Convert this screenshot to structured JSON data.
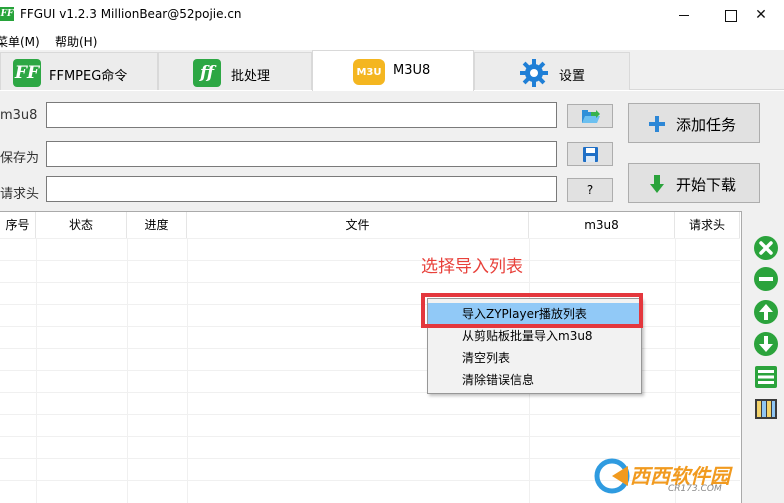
{
  "window": {
    "title": "FFGUI v1.2.3   MillionBear@52pojie.cn",
    "app_icon_text": "FF",
    "close_glyph": "✕"
  },
  "menu": {
    "items": [
      {
        "label": "菜单(M)"
      },
      {
        "label": "帮助(H)"
      }
    ]
  },
  "tabs": [
    {
      "label": "FFMPEG命令",
      "icon": "FF"
    },
    {
      "label": "批处理",
      "icon": "ff"
    },
    {
      "label": "M3U8",
      "icon": "M3U",
      "active": true
    },
    {
      "label": "设置",
      "icon": "gear-icon"
    }
  ],
  "form": {
    "m3u8_label": "m3u8",
    "save_label": "保存为",
    "header_label": "请求头",
    "m3u8_value": "",
    "save_value": "",
    "header_value": "",
    "help_button": "?",
    "add_task": "添加任务",
    "start_download": "开始下载"
  },
  "table": {
    "columns": [
      "序号",
      "状态",
      "进度",
      "文件",
      "m3u8",
      "请求头"
    ]
  },
  "annotation": "选择导入列表",
  "context_menu": {
    "items": [
      {
        "label": "导入ZYPlayer播放列表",
        "highlighted": true
      },
      {
        "label": "从剪贴板批量导入m3u8"
      },
      {
        "label": "清空列表"
      },
      {
        "label": "清除错误信息"
      }
    ]
  },
  "side_toolbar": [
    "remove-icon",
    "minus-icon",
    "up-icon",
    "down-icon",
    "list-icon",
    "book-icon"
  ],
  "watermark": {
    "text": "西西软件园",
    "sub": "CR173.COM"
  },
  "colors": {
    "accent_green": "#2da744",
    "m3u_orange": "#f4b620",
    "annotation_red": "#e8403a",
    "highlight_blue": "#91c9f7"
  }
}
